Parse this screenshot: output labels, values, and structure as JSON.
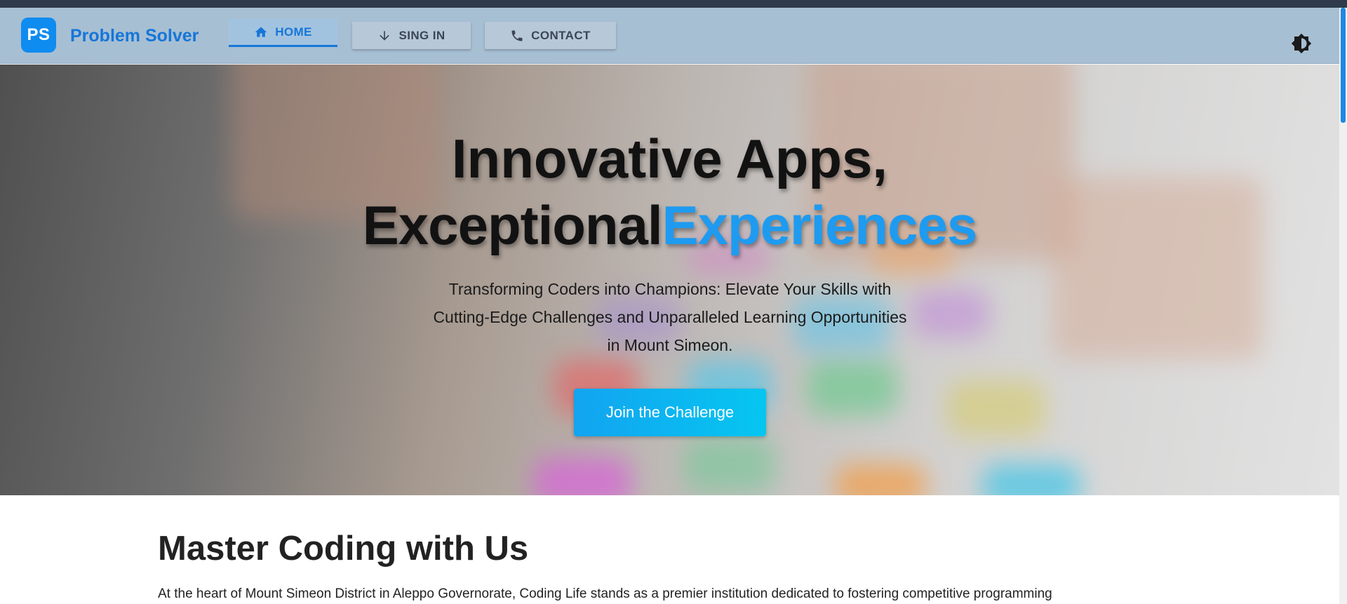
{
  "header": {
    "logo": "PS",
    "brand": "Problem Solver",
    "nav": [
      {
        "label": "HOME",
        "icon": "home-icon",
        "active": true
      },
      {
        "label": "SING IN",
        "icon": "arrow-down-icon",
        "active": false
      },
      {
        "label": "CONTACT",
        "icon": "phone-icon",
        "active": false
      }
    ],
    "theme_toggle_icon": "brightness-icon"
  },
  "hero": {
    "title_line1": "Innovative Apps,",
    "title_line2_a": "Exceptional",
    "title_line2_b": "Experiences",
    "subtitle_line1": "Transforming Coders into Champions: Elevate Your Skills with",
    "subtitle_line2": "Cutting-Edge Challenges and Unparalleled Learning Opportunities",
    "subtitle_line3": "in Mount Simeon.",
    "cta_label": "Join the Challenge"
  },
  "section": {
    "title": "Master Coding with Us",
    "text": "At the heart of Mount Simeon District in Aleppo Governorate, Coding Life stands as a premier institution dedicated to fostering competitive programming"
  },
  "colors": {
    "brand": "#1676d8",
    "accent": "#1e9bf0",
    "navbar": "#a7bfd3",
    "cta_start": "#12a4f0",
    "cta_end": "#06c6f0"
  }
}
